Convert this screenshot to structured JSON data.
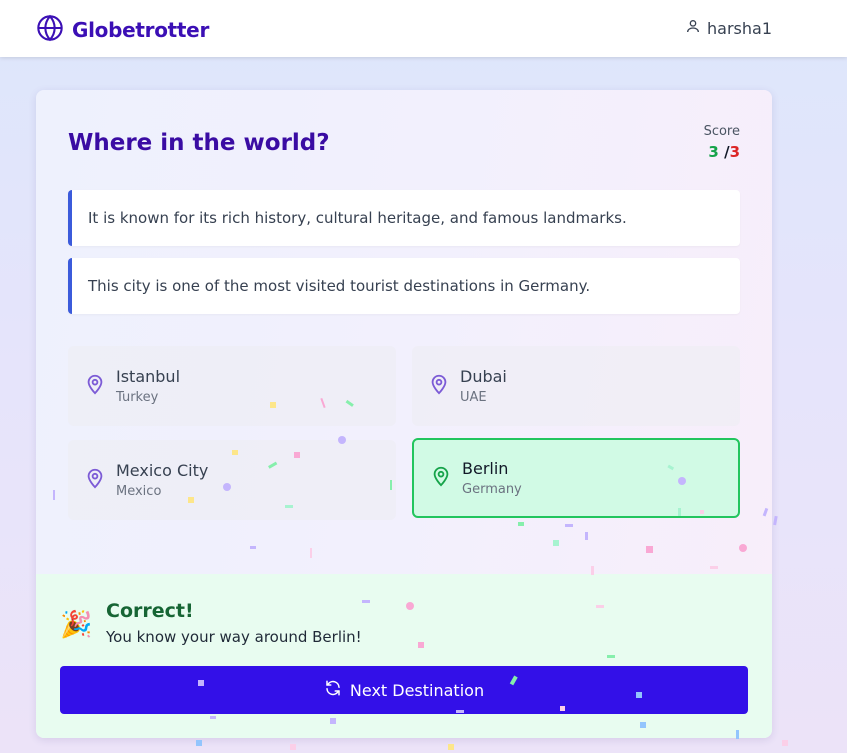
{
  "header": {
    "brand": "Globetrotter",
    "username": "harsha1"
  },
  "game": {
    "title": "Where in the world?",
    "score_label": "Score",
    "score_correct": "3",
    "score_separator": "/",
    "score_total": "3",
    "clues": [
      "It is known for its rich history, cultural heritage, and famous landmarks.",
      "This city is one of the most visited tourist destinations in Germany."
    ],
    "options": [
      {
        "city": "Istanbul",
        "country": "Turkey",
        "selected": false
      },
      {
        "city": "Dubai",
        "country": "UAE",
        "selected": false
      },
      {
        "city": "Mexico City",
        "country": "Mexico",
        "selected": false
      },
      {
        "city": "Berlin",
        "country": "Germany",
        "selected": true
      }
    ],
    "result": {
      "emoji": "🎉",
      "title": "Correct!",
      "message": "You know your way around Berlin!",
      "next_label": "Next Destination"
    }
  },
  "icons": {
    "brand": "globe-icon",
    "user": "user-icon",
    "option": "map-pin-icon",
    "next": "refresh-icon"
  },
  "colors": {
    "brand": "#3b0fb5",
    "accent": "#3310e8",
    "correct": "#16a34a",
    "wrong": "#dc2626",
    "selected_bg": "#d1fae5",
    "selected_border": "#22c55e"
  }
}
